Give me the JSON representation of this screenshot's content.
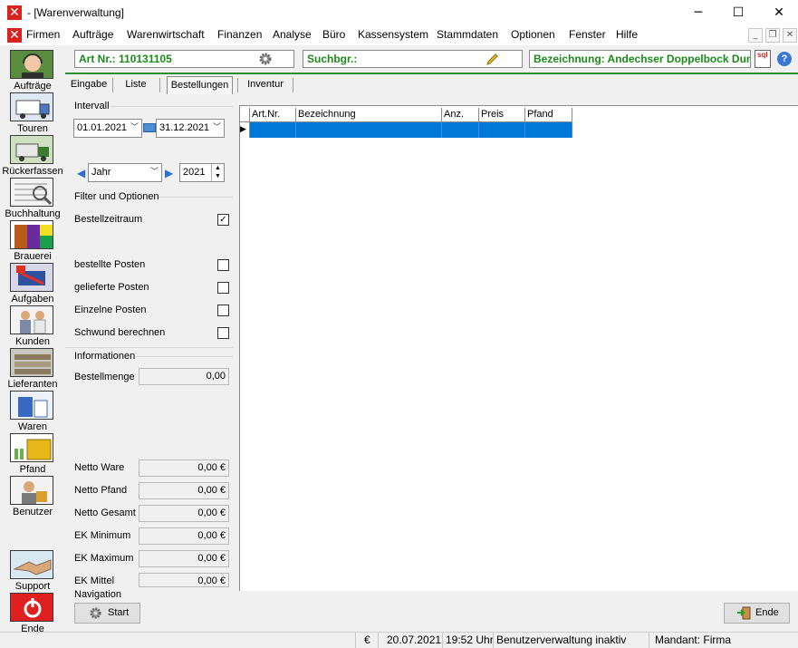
{
  "window": {
    "title": "- [Warenverwaltung]",
    "minimize_glyph": "─",
    "maximize_glyph": "☐",
    "close_glyph": "✕"
  },
  "menu": [
    "Firmen",
    "Aufträge",
    "Warenwirtschaft",
    "Finanzen",
    "Analyse",
    "Büro",
    "Kassensystem",
    "Stammdaten",
    "Optionen",
    "Fenster",
    "Hilfe"
  ],
  "header": {
    "artnr": "Art Nr.: 110131105",
    "suchbegriff": "Suchbgr.:",
    "bezeichnung": "Bezeichnung: Andechser Doppelbock Dunkel",
    "sql_badge": "sql"
  },
  "nav": [
    {
      "label": "Aufträge",
      "icon": "headset-person-icon"
    },
    {
      "label": "Touren",
      "icon": "truck-icon"
    },
    {
      "label": "Rückerfassen",
      "icon": "return-truck-icon"
    },
    {
      "label": "Buchhaltung",
      "icon": "ledger-icon"
    },
    {
      "label": "Brauerei",
      "icon": "brewery-icon"
    },
    {
      "label": "Aufgaben",
      "icon": "tasks-icon"
    },
    {
      "label": "Kunden",
      "icon": "customers-icon"
    },
    {
      "label": "Lieferanten",
      "icon": "warehouse-icon"
    },
    {
      "label": "Waren",
      "icon": "goods-icon"
    },
    {
      "label": "Pfand",
      "icon": "crates-icon"
    },
    {
      "label": "Benutzer",
      "icon": "user-lock-icon"
    },
    {
      "label": "Support",
      "icon": "handshake-icon"
    },
    {
      "label": "Ende",
      "icon": "power-icon"
    }
  ],
  "tabs": [
    "Eingabe",
    "Liste",
    "Bestellungen",
    "Inventur"
  ],
  "active_tab": "Bestellungen",
  "intervall": {
    "label": "Intervall",
    "from": "01.01.2021",
    "to": "31.12.2021",
    "period": "Jahr",
    "year": "2021"
  },
  "filter": {
    "label": "Filter und Optionen",
    "options": [
      {
        "label": "Bestellzeitraum",
        "checked": true,
        "glyph": "✓"
      },
      {
        "label": "bestellte Posten",
        "checked": false,
        "glyph": ""
      },
      {
        "label": "gelieferte Posten",
        "checked": false,
        "glyph": ""
      },
      {
        "label": "Einzelne Posten",
        "checked": false,
        "glyph": ""
      },
      {
        "label": "Schwund berechnen",
        "checked": false,
        "glyph": ""
      }
    ]
  },
  "info": {
    "label": "Informationen",
    "bestellmenge_label": "Bestellmenge",
    "bestellmenge": "0,00",
    "rows": [
      {
        "label": "Netto Ware",
        "value": "0,00 €"
      },
      {
        "label": "Netto Pfand",
        "value": "0,00 €"
      },
      {
        "label": "Netto Gesamt",
        "value": "0,00 €"
      },
      {
        "label": "EK Minimum",
        "value": "0,00 €"
      },
      {
        "label": "EK Maximum",
        "value": "0,00 €"
      },
      {
        "label": "EK Mittel",
        "value": "0,00 €"
      }
    ]
  },
  "grid": {
    "columns": [
      "Art.Nr.",
      "Bezeichnung",
      "Anz.",
      "Preis",
      "Pfand"
    ]
  },
  "navigation": {
    "label": "Navigation",
    "start": "Start",
    "ende": "Ende"
  },
  "status": {
    "currency": "€",
    "date": "20.07.2021",
    "time": "19:52 Uhr",
    "benutzer": "Benutzerverwaltung inaktiv",
    "mandant": "Mandant: Firma"
  },
  "colors": {
    "brand_red": "#d9231f",
    "header_green": "#1b8a1b",
    "selection_blue": "#0078d7"
  }
}
